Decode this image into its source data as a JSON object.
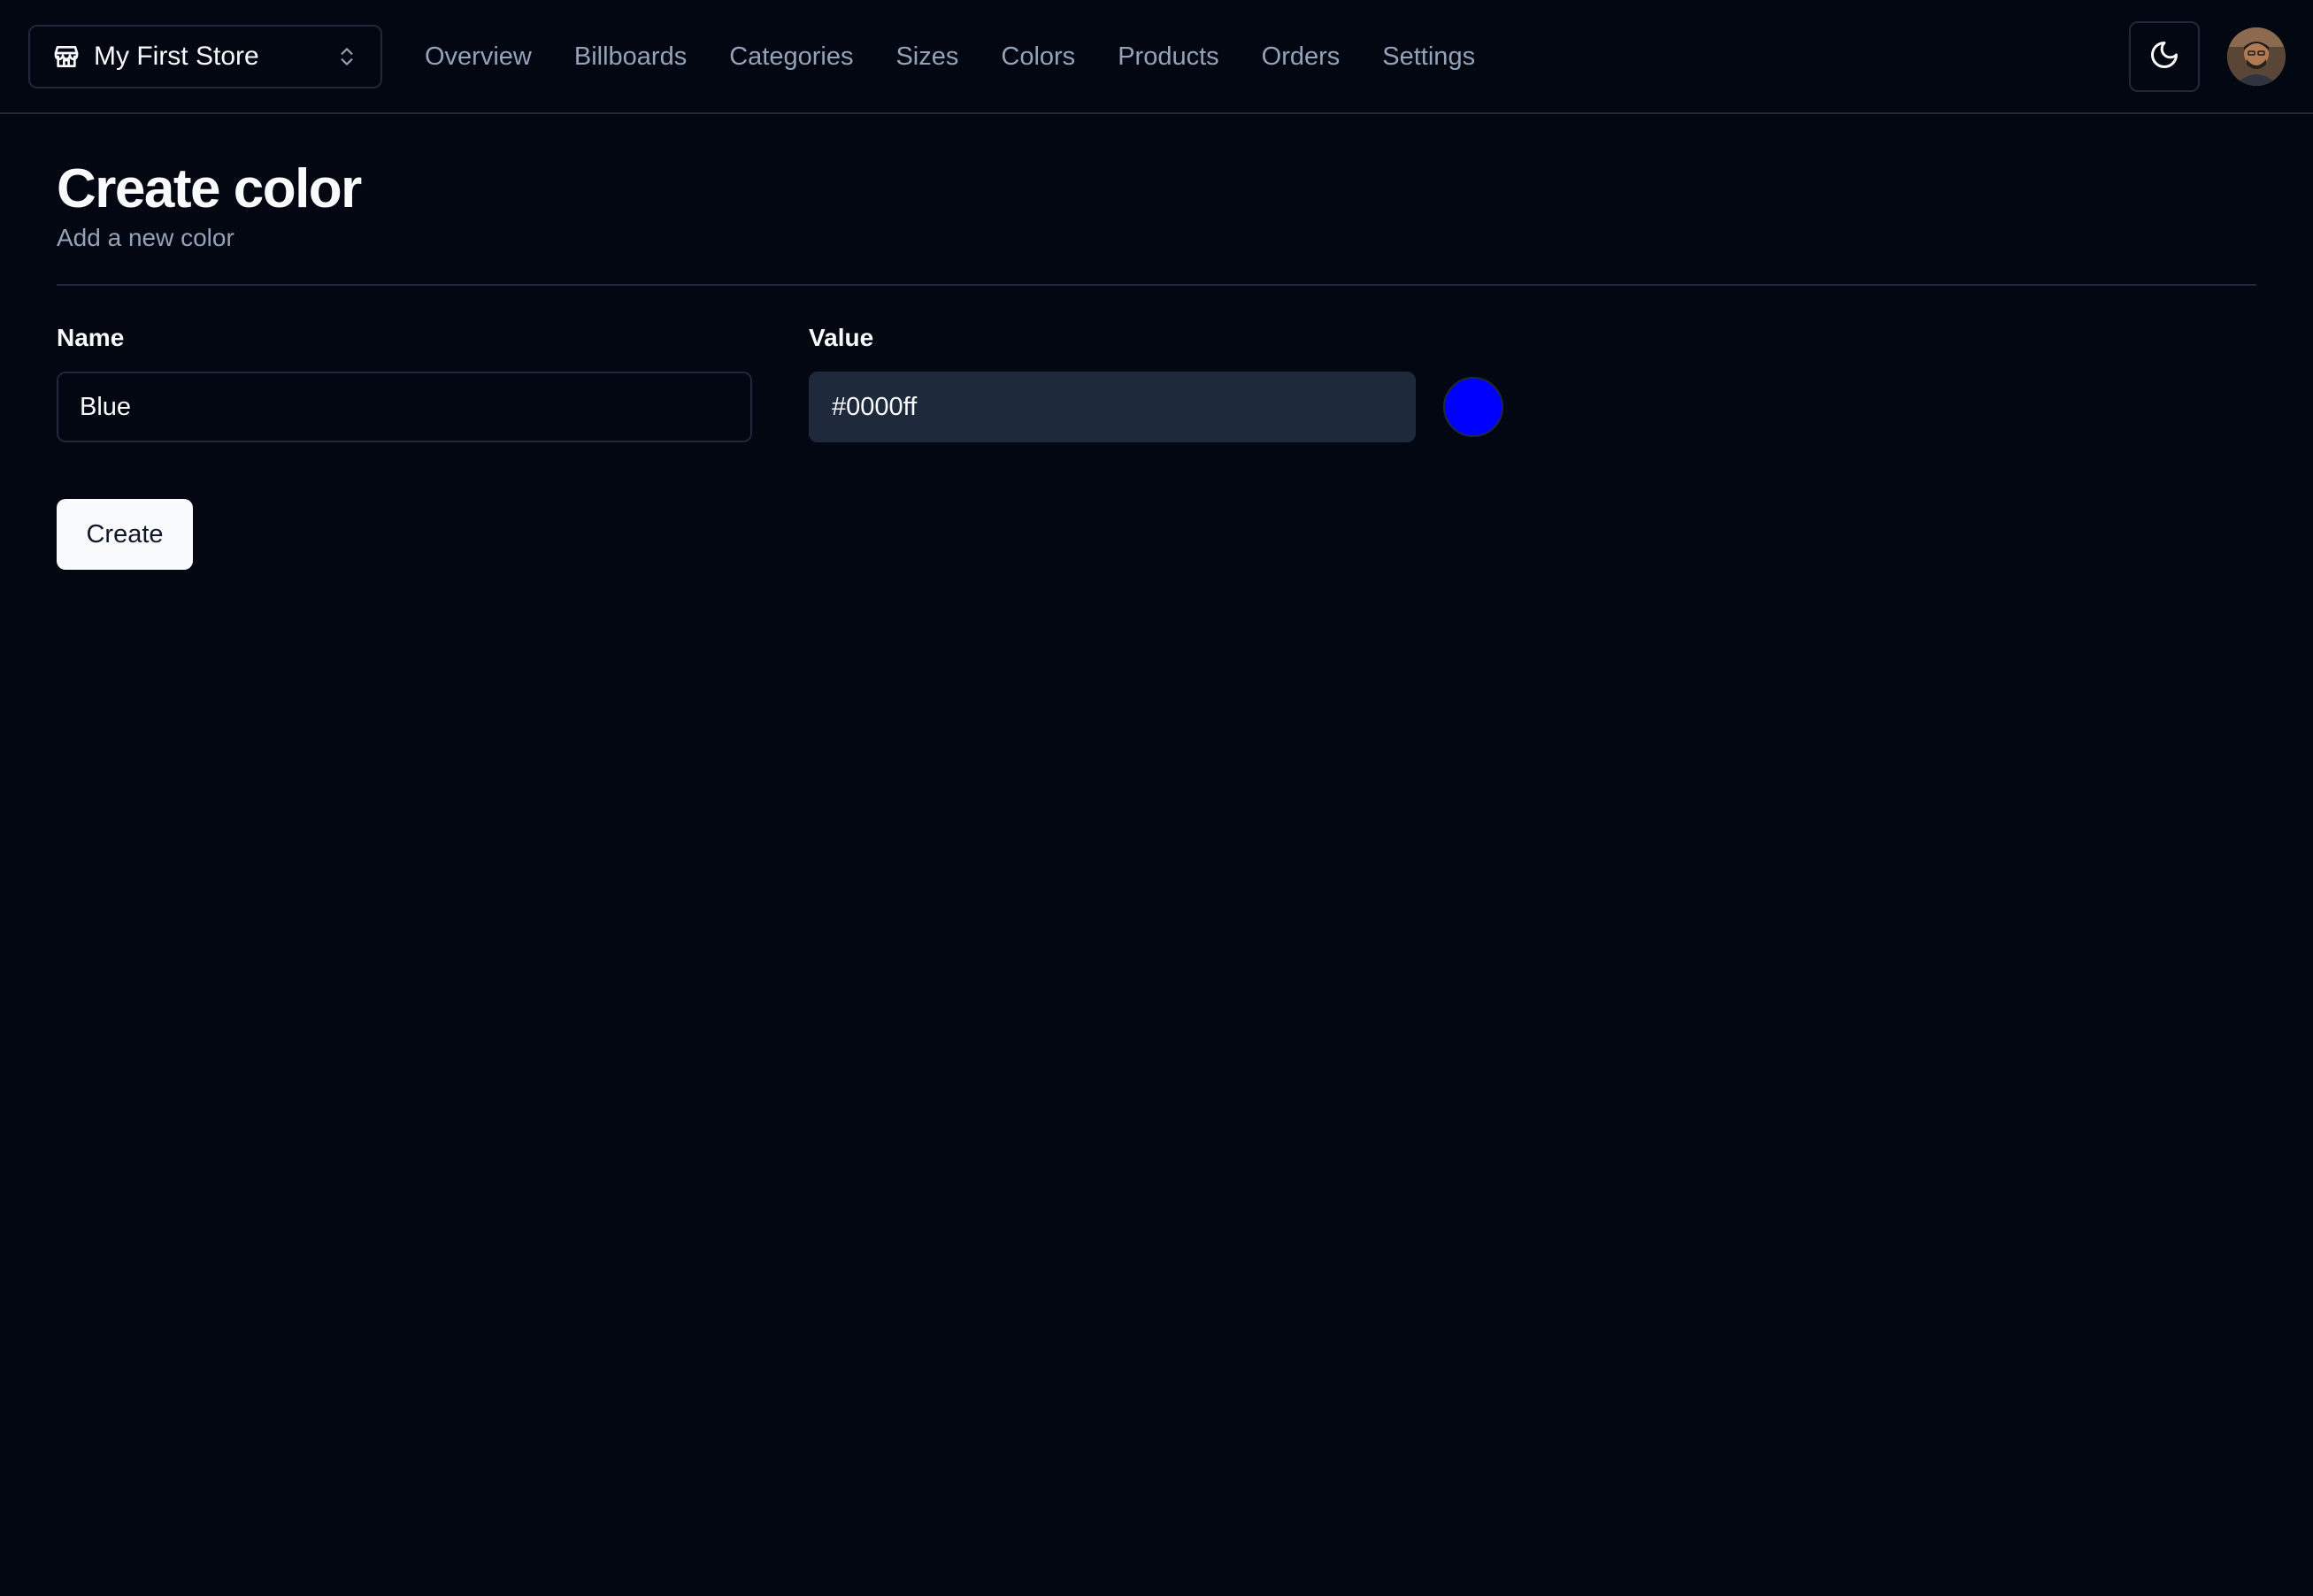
{
  "header": {
    "store_switcher": {
      "label": "My First Store",
      "icon": "store-icon",
      "chevron_icon": "chevrons-up-down-icon"
    },
    "nav": [
      {
        "label": "Overview"
      },
      {
        "label": "Billboards"
      },
      {
        "label": "Categories"
      },
      {
        "label": "Sizes"
      },
      {
        "label": "Colors"
      },
      {
        "label": "Products"
      },
      {
        "label": "Orders"
      },
      {
        "label": "Settings"
      }
    ],
    "theme_toggle_icon": "moon-icon",
    "avatar_icon": "user-avatar"
  },
  "page": {
    "title": "Create color",
    "subtitle": "Add a new color"
  },
  "form": {
    "name_label": "Name",
    "name_value": "Blue",
    "value_label": "Value",
    "value_value": "#0000ff",
    "swatch_color": "#0000ff",
    "submit_label": "Create"
  },
  "colors": {
    "background": "#030712",
    "border": "#1e293b",
    "muted_text": "#94a3b8",
    "primary_button": "#f8fafc"
  }
}
